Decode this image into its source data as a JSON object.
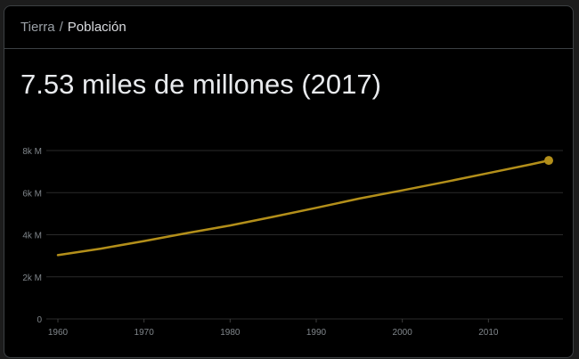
{
  "breadcrumb": {
    "parent": "Tierra",
    "separator": "/",
    "current": "Población"
  },
  "headline": "7.53 miles de millones (2017)",
  "colors": {
    "background": "#000000",
    "line": "#b38f1a",
    "grid": "#2a2a2a",
    "tick_text": "#80868b"
  },
  "chart_data": {
    "type": "line",
    "title": "",
    "xlabel": "",
    "ylabel": "",
    "xlim": [
      1960,
      2017
    ],
    "ylim": [
      0,
      8000000000
    ],
    "y_ticks": [
      {
        "value": 0,
        "label": "0"
      },
      {
        "value": 2000000000,
        "label": "2k M"
      },
      {
        "value": 4000000000,
        "label": "4k M"
      },
      {
        "value": 6000000000,
        "label": "6k M"
      },
      {
        "value": 8000000000,
        "label": "8k M"
      }
    ],
    "x_ticks": [
      {
        "value": 1960,
        "label": "1960"
      },
      {
        "value": 1970,
        "label": "1970"
      },
      {
        "value": 1980,
        "label": "1980"
      },
      {
        "value": 1990,
        "label": "1990"
      },
      {
        "value": 2000,
        "label": "2000"
      },
      {
        "value": 2010,
        "label": "2010"
      }
    ],
    "grid": true,
    "series": [
      {
        "x": [
          1960,
          1965,
          1970,
          1975,
          1980,
          1985,
          1990,
          1995,
          2000,
          2005,
          2010,
          2015,
          2017
        ],
        "y": [
          3030000000,
          3340000000,
          3700000000,
          4080000000,
          4440000000,
          4850000000,
          5280000000,
          5720000000,
          6110000000,
          6510000000,
          6930000000,
          7350000000,
          7530000000
        ]
      }
    ],
    "highlight": {
      "x": 2017,
      "y": 7530000000
    }
  }
}
